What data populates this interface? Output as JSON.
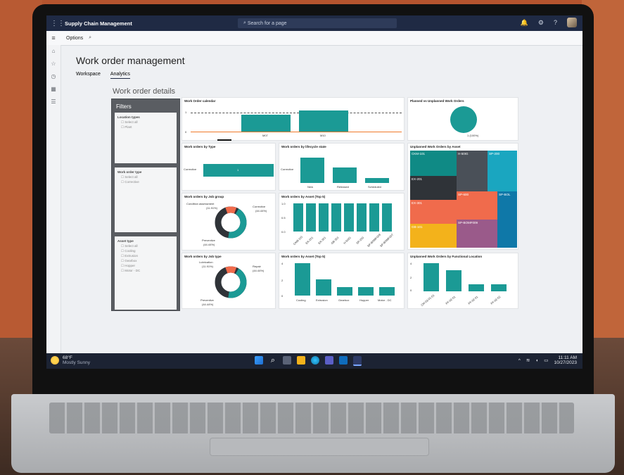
{
  "topbar": {
    "app_title": "Supply Chain Management",
    "search_placeholder": "Search for a page",
    "help": "?"
  },
  "options_bar": {
    "options_label": "Options"
  },
  "page": {
    "title": "Work order management",
    "tabs": [
      {
        "label": "Workspace"
      },
      {
        "label": "Analytics"
      }
    ],
    "section_title": "Work order details"
  },
  "filters": {
    "title": "Filters",
    "groups": [
      {
        "label": "Location types",
        "options": [
          "Select all",
          "Plant"
        ]
      },
      {
        "label": "Work order type",
        "options": [
          "Select all",
          "Corrective"
        ]
      },
      {
        "label": "Asset type",
        "options": [
          "Select all",
          "Cooling",
          "Extrusion",
          "Gearbox",
          "Hopper",
          "Motor - DC"
        ]
      }
    ]
  },
  "cards": {
    "calendar": {
      "title": "Work Order calendar",
      "y_ticks": [
        "1",
        "0"
      ],
      "bars": [
        {
          "label": "M07",
          "value": 1
        },
        {
          "label": "M10",
          "value": 1
        }
      ]
    },
    "planned": {
      "title": "Planned vs Unplanned Work Orders",
      "slice_label": "1 (100%)"
    },
    "by_type": {
      "title": "Work orders by Type",
      "category": "Corrective",
      "value": "1"
    },
    "lifecycle": {
      "title": "Work orders by lifecycle state",
      "y_label": "Corrective",
      "bars": [
        {
          "label": "New",
          "value": 3
        },
        {
          "label": "Released",
          "value": 2
        },
        {
          "label": "Scheduled",
          "value": 0.6
        }
      ]
    },
    "unplanned_asset": {
      "title": "Unplanned Work Orders by Asset",
      "cells": [
        {
          "label": "CKM-101",
          "color": "#0f8a85"
        },
        {
          "label": "H-50IG",
          "color": "#4a5058"
        },
        {
          "label": "SP-200",
          "color": "#1aa6c0"
        },
        {
          "label": "EX-201",
          "color": "#2f3338"
        },
        {
          "label": "SP-600",
          "color": "#f06b4c"
        },
        {
          "label": "SP-BOL",
          "color": "#0f78a8"
        },
        {
          "label": "EX-301",
          "color": "#f06b4c"
        },
        {
          "label": "SP-BOMF009",
          "color": "#9a5a8a"
        },
        {
          "label": "GB-101",
          "color": "#f3b21b"
        }
      ]
    },
    "job_group": {
      "title": "Work orders by Job group",
      "labels": [
        "Condition assessment",
        "(11.91%)",
        "Corrective",
        "(44.44%)",
        "Preventive",
        "(44.44%)"
      ]
    },
    "asset_top5a": {
      "title": "Work orders by Asset (Top 5)",
      "y_ticks": [
        "1.0",
        "0.5",
        "0.0"
      ],
      "x_labels": [
        "CKM-101",
        "EX-201",
        "EX-301",
        "GB-301",
        "H-50IG",
        "SP-200",
        "SP-BOMF009",
        "SP-BOMF007"
      ],
      "values": [
        1,
        1,
        1,
        1,
        1,
        1,
        1,
        1
      ]
    },
    "job_type": {
      "title": "Work orders by Job type",
      "labels": [
        "Lubrication",
        "(11.91%)",
        "Repair",
        "(44.44%)",
        "Preventive",
        "(44.44%)"
      ]
    },
    "asset_top5b": {
      "title": "Work orders by Asset (Top 5)",
      "y_ticks": [
        "4",
        "2",
        "0"
      ],
      "categories": [
        "Cooling",
        "Extrusion",
        "Gearbox",
        "Hopper",
        "Motor - DC"
      ],
      "values": [
        4,
        2,
        1,
        1,
        1
      ]
    },
    "functional": {
      "title": "Unplanned Work Orders by Functional Location",
      "y_ticks": [
        "4",
        "2",
        "0"
      ],
      "categories": [
        "CM-03-01-01",
        "PF-02-01",
        "PF-02-01",
        "PF-02-02"
      ],
      "values": [
        4,
        3,
        1,
        1
      ]
    }
  },
  "taskbar": {
    "temp": "68°F",
    "weather": "Mostly Sunny",
    "time": "11:11 AM",
    "date": "10/27/2023"
  }
}
